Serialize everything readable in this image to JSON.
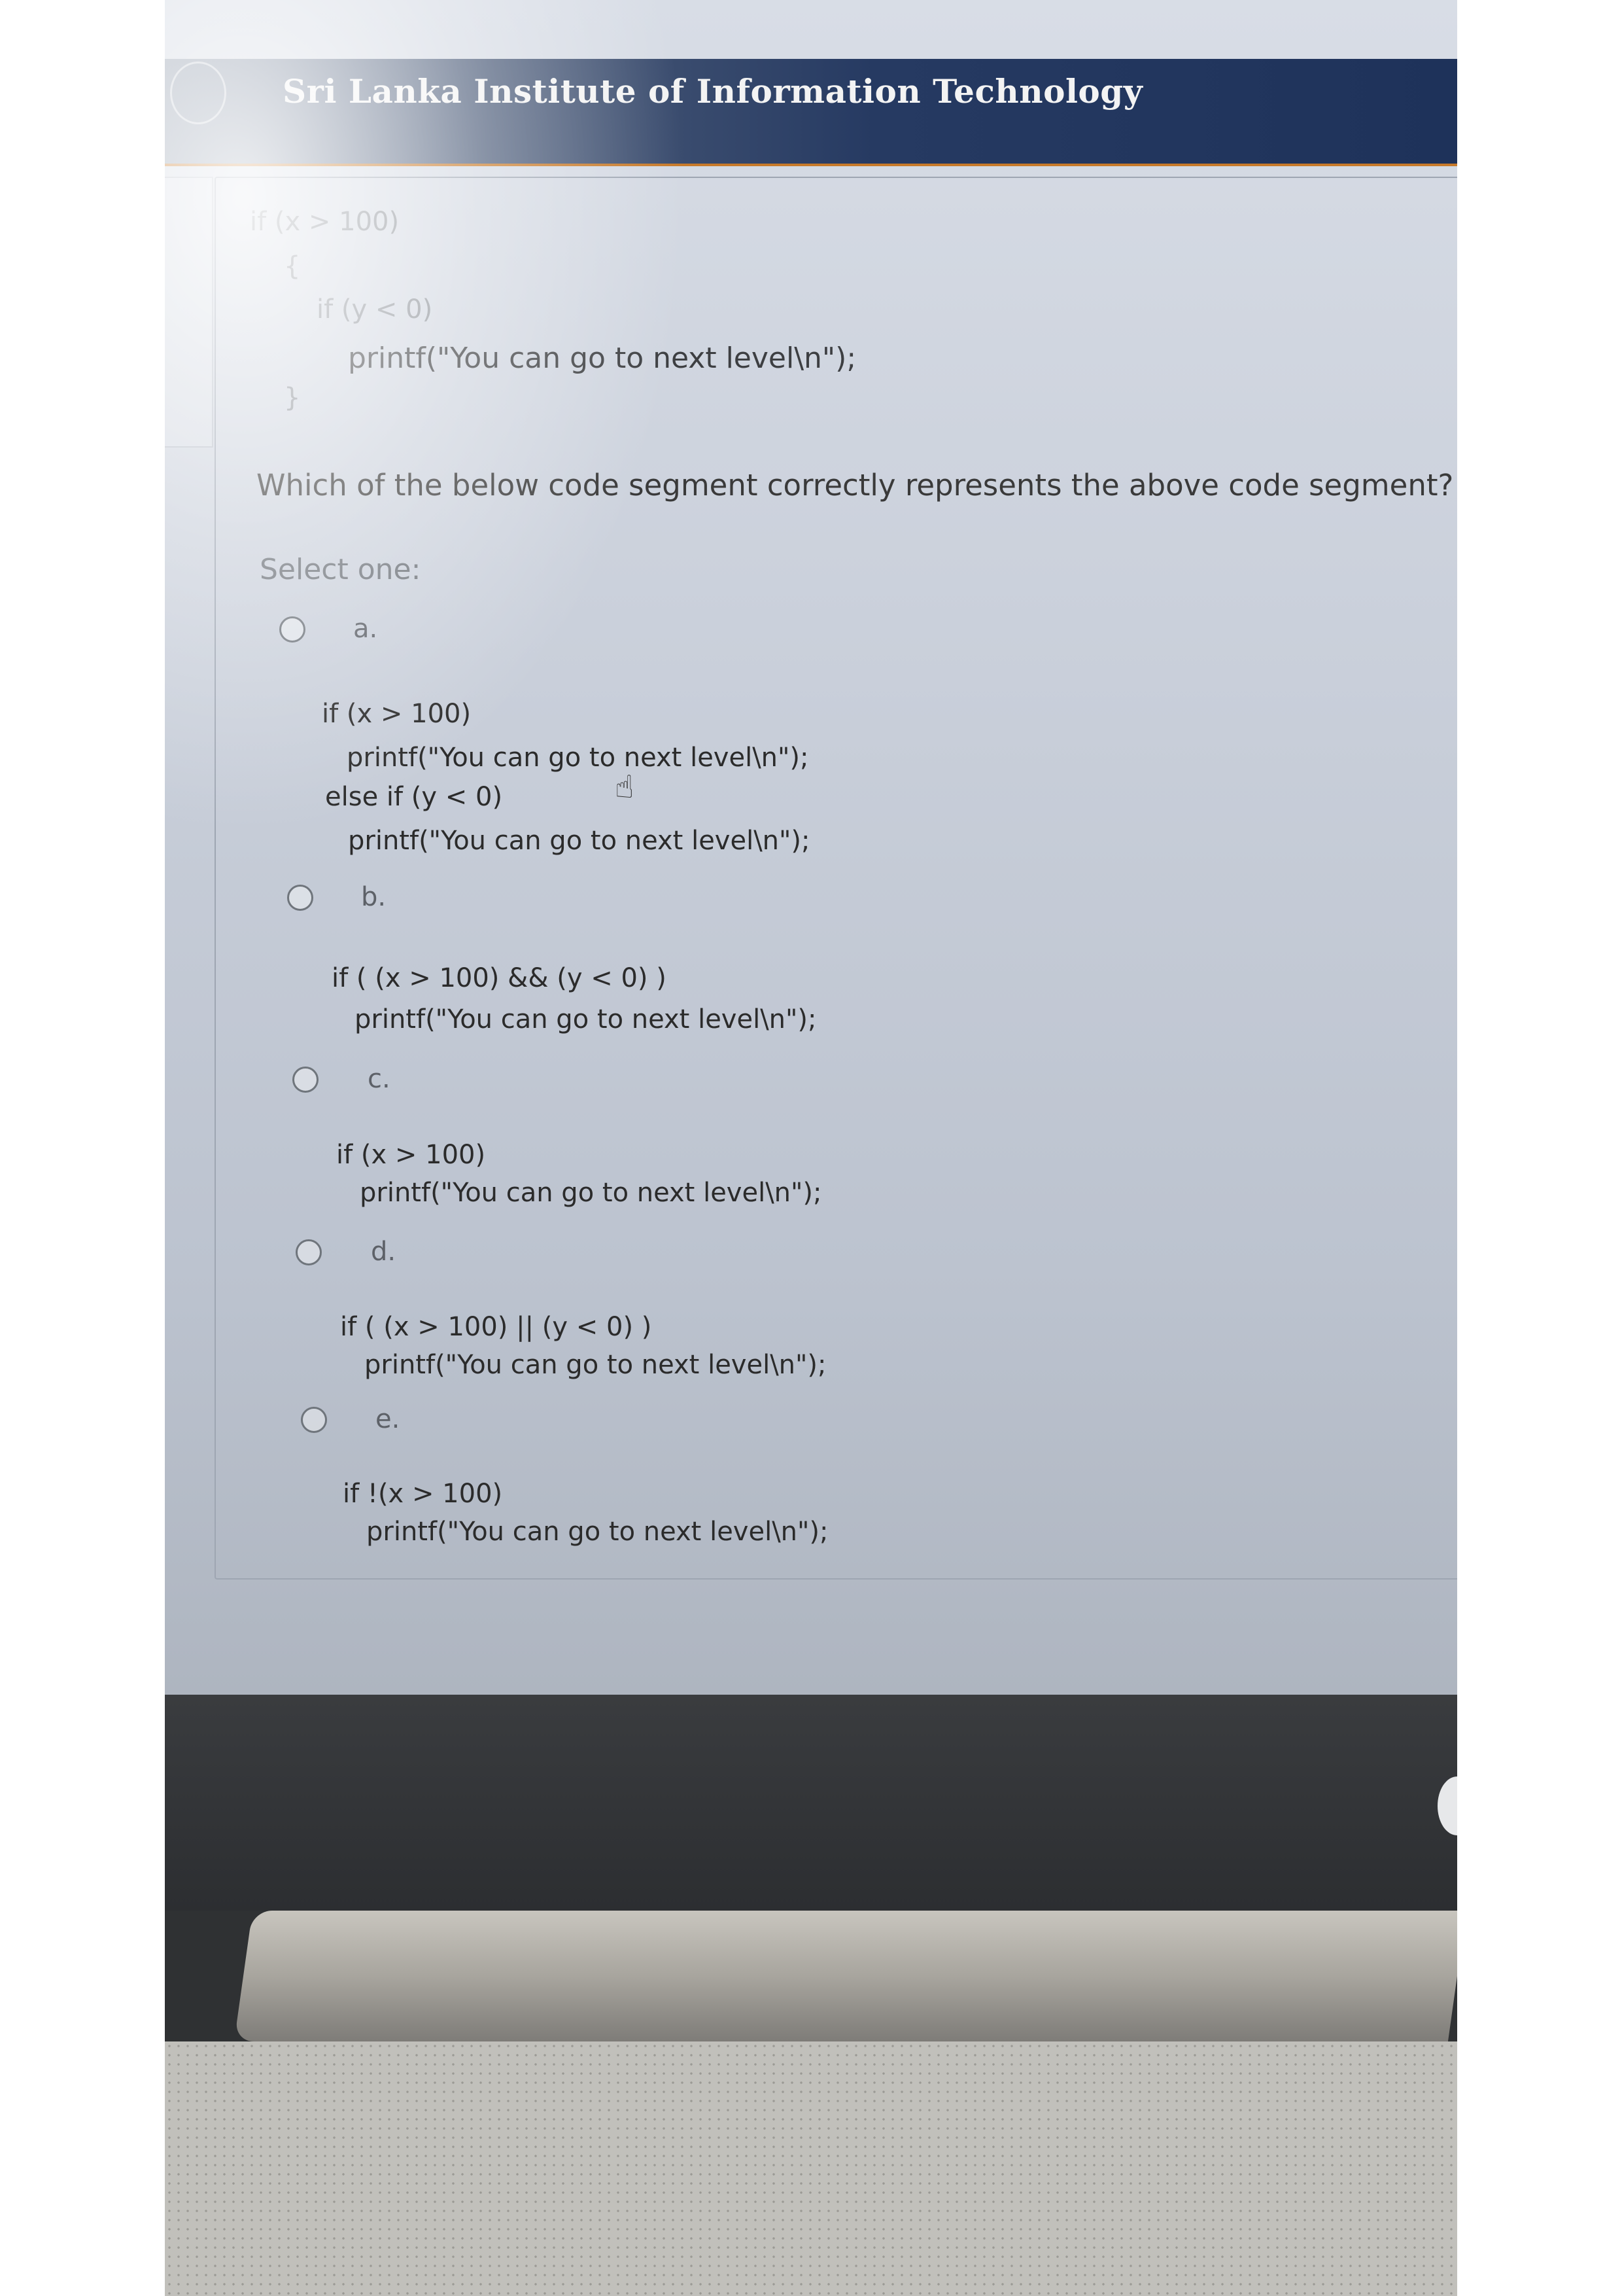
{
  "header": {
    "title": "Sri Lanka Institute of Information Technology"
  },
  "question": {
    "code_lines": [
      "if (x > 100)",
      "{",
      "if (y < 0)",
      "printf(\"You can go to next level\\n\");",
      "}"
    ],
    "text": "Which of the below code segment correctly represents the above code segment?",
    "select_label": "Select one:"
  },
  "options": [
    {
      "letter": "a.",
      "lines": [
        "if (x > 100)",
        "printf(\"You can go to next level\\n\");",
        "else if (y < 0)",
        "printf(\"You can go to next level\\n\");"
      ]
    },
    {
      "letter": "b.",
      "lines": [
        "if ( (x > 100) && (y < 0) )",
        "printf(\"You can go to next level\\n\");"
      ]
    },
    {
      "letter": "c.",
      "lines": [
        "if (x > 100)",
        "printf(\"You can go to next level\\n\");"
      ]
    },
    {
      "letter": "d.",
      "lines": [
        "if ( (x > 100) || (y < 0) )",
        "printf(\"You can go to next level\\n\");"
      ]
    },
    {
      "letter": "e.",
      "lines": [
        "if !(x > 100)",
        "printf(\"You can go to next level\\n\");"
      ]
    }
  ],
  "cursor_icon": "hand-pointer-icon"
}
